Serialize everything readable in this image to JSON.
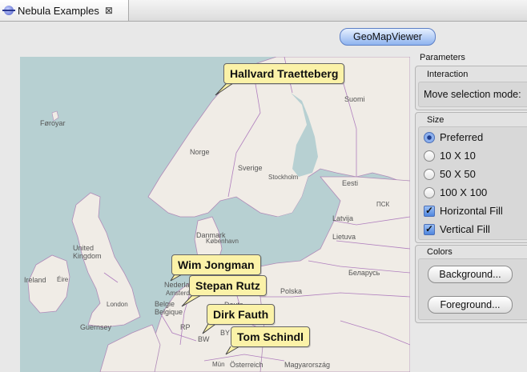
{
  "tab": {
    "title": "Nebula Examples",
    "close": "⊠"
  },
  "example_button": "GeoMapViewer",
  "map": {
    "labels": {
      "suomi": "Suomi",
      "foroyar": "Føroyar",
      "norge": "Norge",
      "sverige": "Sverige",
      "stockholm": "Stockholm",
      "eesti": "Eesti",
      "ckob": "ПСК",
      "latvija": "Latvija",
      "lietuva": "Lietuva",
      "danmark": "Danmark",
      "kobenhavn": "København",
      "united_kingdom": "United\nKingdom",
      "ireland": "Ireland",
      "eire": "Éire",
      "london": "London",
      "nederland": "Nederland",
      "amsterdam": "Amsterdam",
      "belgie": "Belgie",
      "belgique": "Belgique",
      "polska": "Polska",
      "belarus": "Беларусь",
      "deutschland": "Deuts",
      "guernsey": "Guernsey",
      "bw": "BW",
      "by": "BY",
      "osterreich": "Österreich",
      "magyarorszag": "Magyarország",
      "mun": "Mün",
      "rp": "RP"
    },
    "callouts": {
      "hallvard": "Hallvard Traetteberg",
      "wim": "Wim Jongman",
      "stepan": "Stepan Rutz",
      "dirk": "Dirk Fauth",
      "tom": "Tom Schindl"
    }
  },
  "parameters": {
    "title": "Parameters",
    "interaction": {
      "title": "Interaction",
      "label": "Move selection mode:"
    },
    "size": {
      "title": "Size",
      "options": [
        "Preferred",
        "10 X 10",
        "50 X 50",
        "100 X 100"
      ],
      "selected": "Preferred",
      "horizontal_fill": "Horizontal Fill",
      "vertical_fill": "Vertical Fill",
      "check_mark": "✓"
    },
    "colors": {
      "title": "Colors",
      "background_button": "Background...",
      "foreground_button": "Foreground..."
    }
  }
}
